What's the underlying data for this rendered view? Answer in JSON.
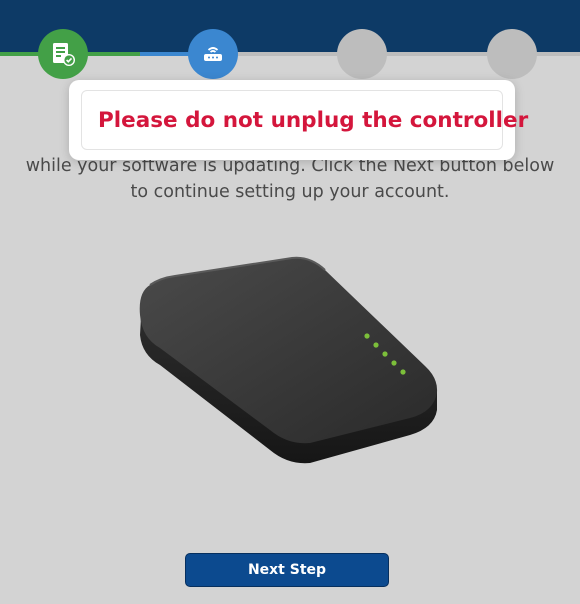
{
  "wizard": {
    "steps": [
      {
        "name": "account-setup",
        "icon": "document-check-icon",
        "status": "complete",
        "color": "#43a047"
      },
      {
        "name": "controller-setup",
        "icon": "router-wifi-icon",
        "status": "active",
        "color": "#3b87d0"
      },
      {
        "name": "step-3",
        "icon": "",
        "status": "pending",
        "color": "#bdbdbd"
      },
      {
        "name": "step-4",
        "icon": "",
        "status": "pending",
        "color": "#bdbdbd"
      }
    ],
    "header_color": "#0d3a66"
  },
  "warning": {
    "title": "Please do not unplug the controller",
    "color": "#d4163c"
  },
  "body": {
    "line1": "while your software is updating. Click the Next button below",
    "line2": "to continue setting up your account."
  },
  "device": {
    "name": "controller-device",
    "led_count": 5,
    "led_color": "#7cbf3a"
  },
  "actions": {
    "next_label": "Next Step"
  }
}
